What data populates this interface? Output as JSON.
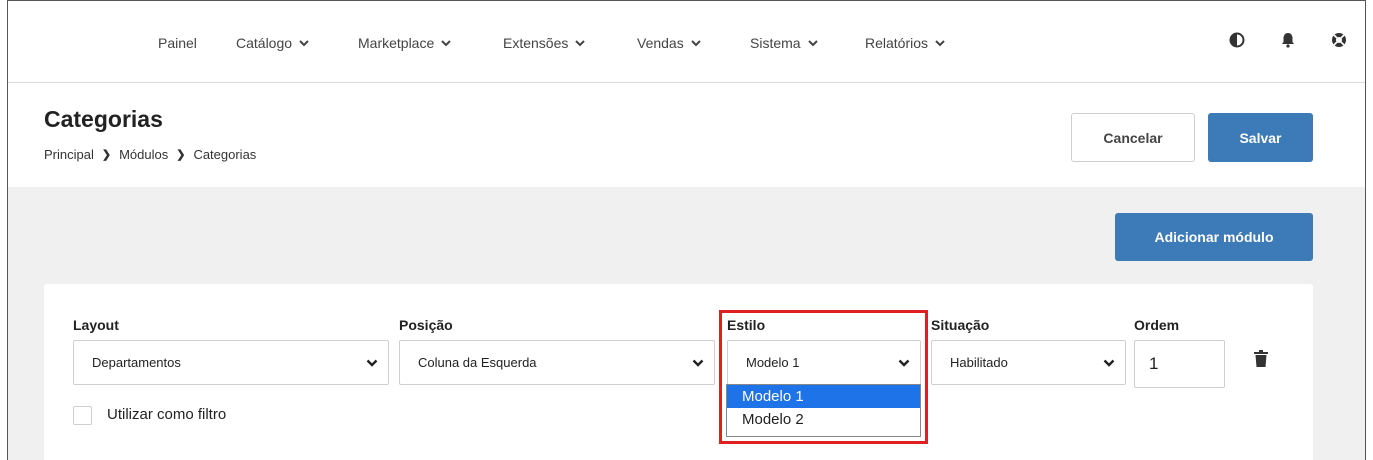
{
  "nav": {
    "items": [
      {
        "label": "Painel",
        "has_dropdown": false
      },
      {
        "label": "Catálogo",
        "has_dropdown": true
      },
      {
        "label": "Marketplace",
        "has_dropdown": true
      },
      {
        "label": "Extensões",
        "has_dropdown": true
      },
      {
        "label": "Vendas",
        "has_dropdown": true
      },
      {
        "label": "Sistema",
        "has_dropdown": true
      },
      {
        "label": "Relatórios",
        "has_dropdown": true
      }
    ],
    "icons": [
      "contrast-icon",
      "bell-icon",
      "lifebuoy-icon"
    ]
  },
  "header": {
    "title": "Categorias",
    "breadcrumb": [
      "Principal",
      "Módulos",
      "Categorias"
    ],
    "cancel_label": "Cancelar",
    "save_label": "Salvar"
  },
  "content": {
    "add_module_label": "Adicionar módulo",
    "fields": {
      "layout": {
        "label": "Layout",
        "value": "Departamentos"
      },
      "position": {
        "label": "Posição",
        "value": "Coluna da Esquerda"
      },
      "style": {
        "label": "Estilo",
        "value": "Modelo 1",
        "options": [
          "Modelo 1",
          "Modelo 2"
        ],
        "selected": "Modelo 1"
      },
      "status": {
        "label": "Situação",
        "value": "Habilitado"
      },
      "order": {
        "label": "Ordem",
        "value": "1"
      }
    },
    "filter_checkbox_label": "Utilizar como filtro"
  },
  "colors": {
    "primary_button": "#3d7ab8",
    "highlight": "#e02020",
    "selected_option": "#1e73e8",
    "content_background": "#f0f0f0"
  }
}
